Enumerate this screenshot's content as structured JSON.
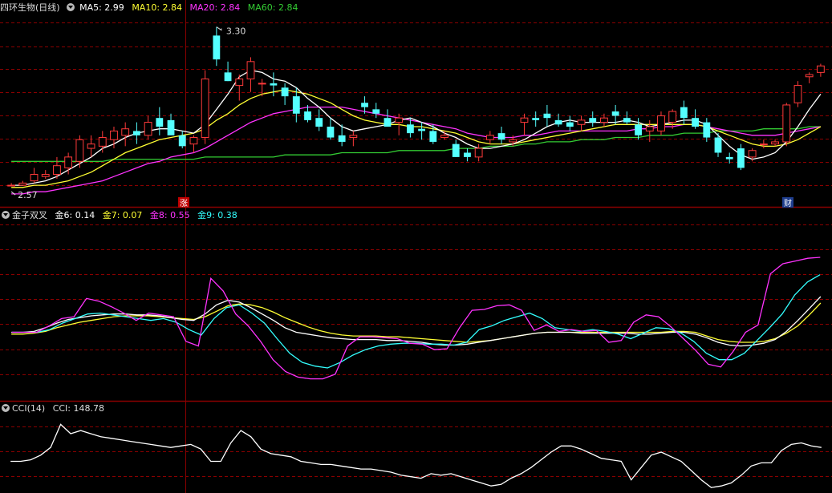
{
  "colors": {
    "up": "#ff3a3a",
    "down": "#54ffff",
    "grid": "#8b0000",
    "ma5": "#ffffff",
    "ma10": "#ffff33",
    "ma20": "#ff33ff",
    "ma60": "#33cc33",
    "jin6": "#ffffff",
    "jin7": "#ffff33",
    "jin8": "#ff33ff",
    "jin9": "#33ffff",
    "cci": "#ffffff",
    "text": "#dddddd"
  },
  "price_panel": {
    "stock_name": "四环生物(日线)",
    "ma_labels": [
      {
        "label": "MA5: 2.99",
        "color": "#ffffff"
      },
      {
        "label": "MA10: 2.84",
        "color": "#ffff33"
      },
      {
        "label": "MA20: 2.84",
        "color": "#ff33ff"
      },
      {
        "label": "MA60: 2.84",
        "color": "#33cc33"
      }
    ],
    "high_marker": "3.30",
    "low_marker": "2.57",
    "event_marker_1": "涨",
    "event_marker_2": "财"
  },
  "indicator_panel": {
    "name": "金子双叉",
    "values": [
      {
        "label": "金6: 0.14",
        "color": "#ffffff"
      },
      {
        "label": "金7: 0.07",
        "color": "#ffff33"
      },
      {
        "label": "金8: 0.55",
        "color": "#ff33ff"
      },
      {
        "label": "金9: 0.38",
        "color": "#33ffff"
      }
    ]
  },
  "cci_panel": {
    "name": "CCI(14)",
    "value_label": "CCI: 148.78"
  },
  "chart_data": {
    "type": "candlestick",
    "price_range": [
      2.5,
      3.35
    ],
    "candles": [
      [
        2.57,
        2.58,
        2.57,
        2.57
      ],
      [
        2.57,
        2.59,
        2.58,
        2.58
      ],
      [
        2.59,
        2.65,
        2.58,
        2.62
      ],
      [
        2.61,
        2.64,
        2.6,
        2.62
      ],
      [
        2.62,
        2.7,
        2.6,
        2.66
      ],
      [
        2.65,
        2.72,
        2.62,
        2.7
      ],
      [
        2.68,
        2.8,
        2.65,
        2.78
      ],
      [
        2.74,
        2.8,
        2.7,
        2.76
      ],
      [
        2.75,
        2.82,
        2.72,
        2.79
      ],
      [
        2.78,
        2.84,
        2.74,
        2.82
      ],
      [
        2.8,
        2.86,
        2.75,
        2.83
      ],
      [
        2.82,
        2.86,
        2.76,
        2.8
      ],
      [
        2.8,
        2.89,
        2.78,
        2.86
      ],
      [
        2.88,
        2.93,
        2.8,
        2.84
      ],
      [
        2.87,
        2.9,
        2.82,
        2.8
      ],
      [
        2.8,
        2.82,
        2.74,
        2.75
      ],
      [
        2.76,
        2.8,
        2.72,
        2.79
      ],
      [
        2.79,
        3.1,
        2.76,
        3.06
      ],
      [
        3.26,
        3.3,
        3.12,
        3.15
      ],
      [
        3.09,
        3.14,
        3.05,
        3.05
      ],
      [
        3.03,
        3.08,
        2.96,
        3.06
      ],
      [
        3.06,
        3.16,
        3.0,
        3.14
      ],
      [
        3.04,
        3.06,
        2.98,
        3.04
      ],
      [
        3.04,
        3.09,
        2.98,
        3.03
      ],
      [
        3.02,
        3.04,
        2.94,
        2.98
      ],
      [
        2.98,
        3.02,
        2.86,
        2.9
      ],
      [
        2.91,
        2.94,
        2.86,
        2.87
      ],
      [
        2.88,
        2.92,
        2.82,
        2.84
      ],
      [
        2.84,
        2.88,
        2.78,
        2.79
      ],
      [
        2.8,
        2.85,
        2.75,
        2.77
      ],
      [
        2.79,
        2.82,
        2.75,
        2.8
      ],
      [
        2.95,
        2.98,
        2.9,
        2.93
      ],
      [
        2.92,
        2.95,
        2.88,
        2.9
      ],
      [
        2.88,
        2.92,
        2.84,
        2.84
      ],
      [
        2.86,
        2.9,
        2.8,
        2.88
      ],
      [
        2.85,
        2.88,
        2.79,
        2.81
      ],
      [
        2.83,
        2.86,
        2.78,
        2.82
      ],
      [
        2.82,
        2.85,
        2.76,
        2.77
      ],
      [
        2.79,
        2.82,
        2.78,
        2.8
      ],
      [
        2.76,
        2.78,
        2.7,
        2.7
      ],
      [
        2.72,
        2.74,
        2.68,
        2.7
      ],
      [
        2.7,
        2.76,
        2.68,
        2.74
      ],
      [
        2.78,
        2.82,
        2.76,
        2.8
      ],
      [
        2.81,
        2.84,
        2.76,
        2.78
      ],
      [
        2.77,
        2.8,
        2.75,
        2.78
      ],
      [
        2.86,
        2.9,
        2.8,
        2.88
      ],
      [
        2.88,
        2.91,
        2.84,
        2.87
      ],
      [
        2.9,
        2.94,
        2.84,
        2.88
      ],
      [
        2.87,
        2.9,
        2.84,
        2.85
      ],
      [
        2.86,
        2.89,
        2.82,
        2.84
      ],
      [
        2.85,
        2.89,
        2.82,
        2.87
      ],
      [
        2.88,
        2.91,
        2.84,
        2.86
      ],
      [
        2.86,
        2.9,
        2.84,
        2.88
      ],
      [
        2.91,
        2.94,
        2.85,
        2.89
      ],
      [
        2.88,
        2.91,
        2.85,
        2.86
      ],
      [
        2.85,
        2.88,
        2.78,
        2.8
      ],
      [
        2.82,
        2.87,
        2.77,
        2.84
      ],
      [
        2.82,
        2.91,
        2.8,
        2.89
      ],
      [
        2.86,
        2.92,
        2.83,
        2.91
      ],
      [
        2.93,
        2.96,
        2.85,
        2.88
      ],
      [
        2.88,
        2.92,
        2.83,
        2.84
      ],
      [
        2.86,
        2.88,
        2.77,
        2.79
      ],
      [
        2.79,
        2.81,
        2.7,
        2.72
      ],
      [
        2.7,
        2.72,
        2.67,
        2.69
      ],
      [
        2.74,
        2.76,
        2.64,
        2.65
      ],
      [
        2.7,
        2.74,
        2.68,
        2.73
      ],
      [
        2.76,
        2.78,
        2.74,
        2.76
      ],
      [
        2.76,
        2.78,
        2.75,
        2.77
      ],
      [
        2.77,
        2.95,
        2.75,
        2.94
      ],
      [
        2.95,
        3.05,
        2.93,
        3.03
      ],
      [
        3.07,
        3.09,
        3.04,
        3.08
      ],
      [
        3.09,
        3.13,
        3.07,
        3.12
      ]
    ],
    "ma5": [
      2.57,
      2.57,
      2.58,
      2.59,
      2.61,
      2.64,
      2.67,
      2.7,
      2.74,
      2.76,
      2.79,
      2.81,
      2.82,
      2.83,
      2.83,
      2.82,
      2.81,
      2.85,
      2.92,
      2.99,
      3.07,
      3.1,
      3.09,
      3.06,
      3.05,
      3.02,
      2.97,
      2.93,
      2.88,
      2.84,
      2.82,
      2.83,
      2.84,
      2.85,
      2.87,
      2.88,
      2.86,
      2.84,
      2.81,
      2.79,
      2.76,
      2.74,
      2.74,
      2.75,
      2.76,
      2.78,
      2.81,
      2.84,
      2.86,
      2.87,
      2.86,
      2.86,
      2.86,
      2.86,
      2.87,
      2.86,
      2.84,
      2.85,
      2.86,
      2.87,
      2.87,
      2.85,
      2.8,
      2.75,
      2.71,
      2.69,
      2.7,
      2.72,
      2.77,
      2.84,
      2.92,
      2.99
    ],
    "ma10": [
      2.56,
      2.56,
      2.57,
      2.57,
      2.58,
      2.59,
      2.61,
      2.63,
      2.66,
      2.69,
      2.72,
      2.74,
      2.76,
      2.78,
      2.79,
      2.8,
      2.81,
      2.83,
      2.87,
      2.9,
      2.94,
      2.97,
      2.99,
      3.0,
      3.01,
      3.0,
      2.99,
      2.97,
      2.95,
      2.92,
      2.89,
      2.87,
      2.86,
      2.85,
      2.85,
      2.84,
      2.84,
      2.83,
      2.82,
      2.81,
      2.79,
      2.77,
      2.76,
      2.76,
      2.76,
      2.77,
      2.78,
      2.79,
      2.8,
      2.81,
      2.82,
      2.83,
      2.84,
      2.85,
      2.85,
      2.85,
      2.85,
      2.85,
      2.85,
      2.85,
      2.85,
      2.84,
      2.82,
      2.8,
      2.78,
      2.76,
      2.75,
      2.75,
      2.76,
      2.78,
      2.81,
      2.84
    ],
    "ma20": [
      2.53,
      2.53,
      2.54,
      2.54,
      2.55,
      2.56,
      2.57,
      2.58,
      2.59,
      2.61,
      2.63,
      2.65,
      2.67,
      2.68,
      2.7,
      2.71,
      2.72,
      2.74,
      2.77,
      2.8,
      2.83,
      2.86,
      2.88,
      2.9,
      2.91,
      2.92,
      2.93,
      2.93,
      2.93,
      2.93,
      2.92,
      2.91,
      2.9,
      2.89,
      2.88,
      2.87,
      2.86,
      2.85,
      2.84,
      2.83,
      2.81,
      2.8,
      2.79,
      2.79,
      2.79,
      2.8,
      2.8,
      2.81,
      2.82,
      2.82,
      2.82,
      2.82,
      2.82,
      2.82,
      2.82,
      2.83,
      2.83,
      2.84,
      2.84,
      2.85,
      2.85,
      2.84,
      2.83,
      2.82,
      2.81,
      2.8,
      2.8,
      2.8,
      2.81,
      2.82,
      2.83,
      2.84
    ],
    "ma60": [
      2.68,
      2.68,
      2.68,
      2.68,
      2.68,
      2.68,
      2.68,
      2.68,
      2.68,
      2.69,
      2.69,
      2.69,
      2.69,
      2.69,
      2.69,
      2.69,
      2.69,
      2.7,
      2.7,
      2.7,
      2.7,
      2.7,
      2.7,
      2.7,
      2.71,
      2.71,
      2.71,
      2.71,
      2.71,
      2.72,
      2.72,
      2.72,
      2.72,
      2.72,
      2.73,
      2.73,
      2.73,
      2.73,
      2.73,
      2.74,
      2.74,
      2.74,
      2.75,
      2.75,
      2.75,
      2.76,
      2.76,
      2.77,
      2.77,
      2.77,
      2.78,
      2.78,
      2.78,
      2.79,
      2.79,
      2.79,
      2.8,
      2.8,
      2.8,
      2.81,
      2.81,
      2.81,
      2.82,
      2.82,
      2.82,
      2.82,
      2.83,
      2.83,
      2.83,
      2.83,
      2.84,
      2.84
    ],
    "indicator_range": [
      -1.0,
      1.0
    ],
    "jin6": [
      -0.25,
      -0.25,
      -0.24,
      -0.2,
      -0.15,
      -0.11,
      -0.09,
      -0.07,
      -0.06,
      -0.05,
      -0.05,
      -0.06,
      -0.06,
      -0.07,
      -0.09,
      -0.11,
      -0.12,
      -0.05,
      0.05,
      0.1,
      0.08,
      0.02,
      -0.05,
      -0.12,
      -0.2,
      -0.25,
      -0.27,
      -0.29,
      -0.31,
      -0.32,
      -0.33,
      -0.33,
      -0.33,
      -0.34,
      -0.34,
      -0.35,
      -0.36,
      -0.38,
      -0.39,
      -0.39,
      -0.38,
      -0.36,
      -0.34,
      -0.32,
      -0.3,
      -0.28,
      -0.26,
      -0.25,
      -0.25,
      -0.25,
      -0.26,
      -0.26,
      -0.26,
      -0.26,
      -0.26,
      -0.27,
      -0.27,
      -0.26,
      -0.25,
      -0.25,
      -0.27,
      -0.31,
      -0.36,
      -0.39,
      -0.4,
      -0.39,
      -0.37,
      -0.33,
      -0.24,
      -0.12,
      0.01,
      0.14
    ],
    "jin7": [
      -0.27,
      -0.27,
      -0.26,
      -0.24,
      -0.2,
      -0.17,
      -0.14,
      -0.12,
      -0.1,
      -0.08,
      -0.07,
      -0.07,
      -0.07,
      -0.08,
      -0.09,
      -0.1,
      -0.11,
      -0.08,
      -0.02,
      0.04,
      0.06,
      0.05,
      0.02,
      -0.03,
      -0.09,
      -0.14,
      -0.19,
      -0.23,
      -0.26,
      -0.28,
      -0.29,
      -0.29,
      -0.29,
      -0.3,
      -0.3,
      -0.31,
      -0.32,
      -0.33,
      -0.34,
      -0.35,
      -0.36,
      -0.35,
      -0.34,
      -0.32,
      -0.3,
      -0.28,
      -0.26,
      -0.25,
      -0.25,
      -0.25,
      -0.25,
      -0.25,
      -0.25,
      -0.25,
      -0.25,
      -0.25,
      -0.25,
      -0.25,
      -0.24,
      -0.24,
      -0.25,
      -0.29,
      -0.33,
      -0.35,
      -0.36,
      -0.36,
      -0.35,
      -0.32,
      -0.26,
      -0.18,
      -0.06,
      0.07
    ],
    "jin8": [
      -0.25,
      -0.25,
      -0.25,
      -0.18,
      -0.1,
      -0.08,
      0.12,
      0.09,
      0.03,
      -0.04,
      -0.12,
      -0.04,
      -0.06,
      -0.08,
      -0.35,
      -0.4,
      0.34,
      0.2,
      -0.05,
      -0.18,
      -0.35,
      -0.55,
      -0.68,
      -0.74,
      -0.76,
      -0.76,
      -0.71,
      -0.4,
      -0.3,
      -0.3,
      -0.31,
      -0.32,
      -0.37,
      -0.38,
      -0.44,
      -0.43,
      -0.2,
      -0.01,
      0.0,
      0.04,
      0.05,
      -0.01,
      -0.23,
      -0.17,
      -0.24,
      -0.22,
      -0.24,
      -0.23,
      -0.36,
      -0.34,
      -0.14,
      -0.06,
      -0.08,
      -0.19,
      -0.32,
      -0.45,
      -0.6,
      -0.63,
      -0.46,
      -0.25,
      -0.17,
      0.39,
      0.5,
      0.53,
      0.56,
      0.57
    ],
    "jin9": [
      -0.25,
      -0.25,
      -0.25,
      -0.22,
      -0.15,
      -0.1,
      -0.05,
      -0.04,
      -0.06,
      -0.08,
      -0.1,
      -0.12,
      -0.1,
      -0.14,
      -0.22,
      -0.28,
      -0.1,
      0.02,
      0.05,
      -0.04,
      -0.15,
      -0.32,
      -0.48,
      -0.58,
      -0.62,
      -0.64,
      -0.58,
      -0.5,
      -0.44,
      -0.4,
      -0.38,
      -0.37,
      -0.37,
      -0.38,
      -0.38,
      -0.39,
      -0.36,
      -0.22,
      -0.18,
      -0.12,
      -0.08,
      -0.04,
      -0.1,
      -0.2,
      -0.22,
      -0.24,
      -0.22,
      -0.24,
      -0.27,
      -0.32,
      -0.26,
      -0.2,
      -0.21,
      -0.26,
      -0.35,
      -0.48,
      -0.55,
      -0.55,
      -0.48,
      -0.34,
      -0.2,
      -0.05,
      0.16,
      0.3,
      0.38
    ],
    "cci_range": [
      -250,
      250
    ],
    "cci": [
      -60,
      -60,
      -50,
      -20,
      30,
      180,
      120,
      140,
      120,
      100,
      90,
      80,
      70,
      60,
      50,
      40,
      30,
      40,
      50,
      20,
      -60,
      -60,
      60,
      140,
      100,
      20,
      -10,
      -20,
      -30,
      -60,
      -70,
      -80,
      -80,
      -90,
      -100,
      -110,
      -110,
      -120,
      -130,
      -150,
      -160,
      -170,
      -140,
      -150,
      -140,
      -160,
      -180,
      -200,
      -220,
      -210,
      -170,
      -140,
      -100,
      -50,
      0,
      40,
      40,
      20,
      -10,
      -40,
      -50,
      -60,
      -180,
      -100,
      -20,
      0,
      -30,
      -60,
      -120,
      -180,
      -230,
      -220,
      -200,
      -150,
      -90,
      -70,
      -70,
      10,
      50,
      60,
      40,
      30
    ]
  }
}
